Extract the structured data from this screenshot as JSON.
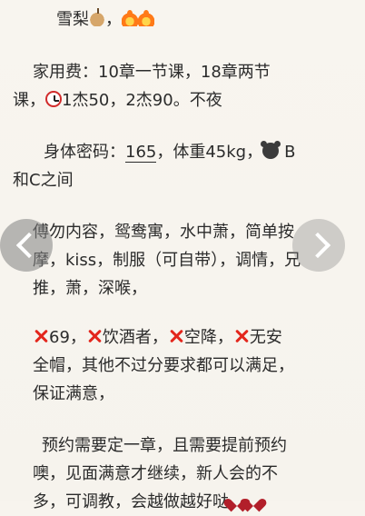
{
  "lines": {
    "l1": "雪梨",
    "l1_sep": "，",
    "l2": "家用费：10章一节课，18章两节",
    "l3a": "课，",
    "l3b": "1杰50，2杰90。不夜",
    "l4a": "身体密码：",
    "l4_num": "165",
    "l4b": "，体重45kg，",
    "l4_end": "B",
    "l5": "和C之间",
    "l6": "傅勿内容，鸳鸯寓，水中萧，简单按",
    "l7": "摩，kiss，制服（可自带），调情，兄",
    "l8": "推，萧，深喉，",
    "l9a": "69，",
    "l9b": "饮酒者，",
    "l9c": "空降，",
    "l9d": "无安",
    "l10": "全帽，其他不过分要求都可以满足，",
    "l11": "保证满意，",
    "l12": "预约需要定一章，且需要提前预约",
    "l13": "噢，见面满意才继续，新人会的不",
    "l14": "多，可调教，会越做越好哒"
  },
  "icons": {
    "pear": "pear-emoji-icon",
    "fire": "fire-emoji-icon",
    "alarm": "alarm-clock-icon",
    "bear": "bear-face-icon",
    "cross": "red-cross-icon",
    "heart": "heart-icon",
    "prev": "chevron-left-icon",
    "next": "chevron-right-icon"
  }
}
